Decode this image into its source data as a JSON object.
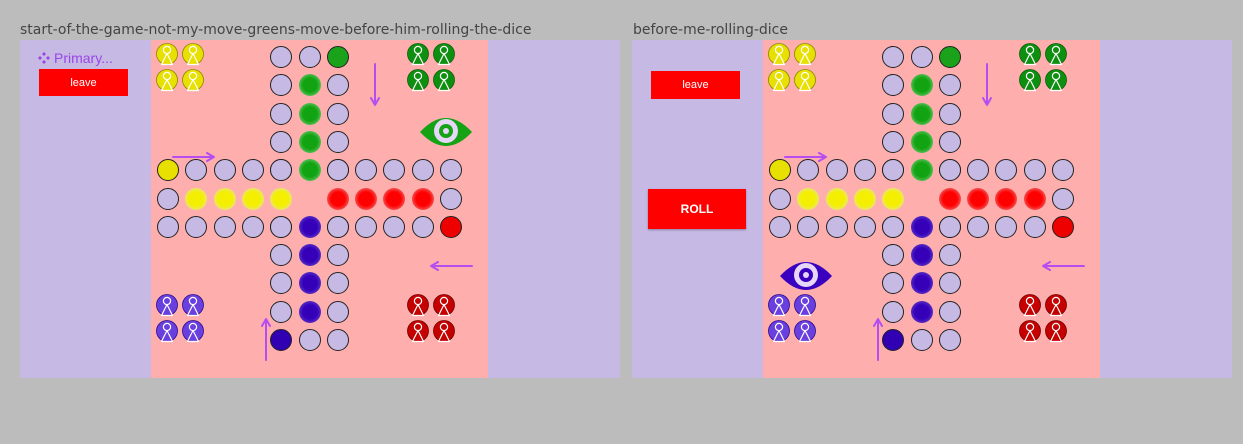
{
  "frames": [
    {
      "title": "start-of-the-game-not-my-move-greens-move-before-him-rolling-the-dice",
      "primary_label": "Primary...",
      "leave_label": "leave",
      "roll_label": "",
      "eye_player": "green"
    },
    {
      "title": "before-me-rolling-dice",
      "primary_label": "",
      "leave_label": "leave",
      "roll_label": "ROLL",
      "eye_player": "blue"
    }
  ],
  "colors": {
    "background": "#bcbcbc",
    "frame": "#c6b9e4",
    "board": "#ffaeae",
    "green": "#1aa31a",
    "yellow": "#e8e000",
    "red": "#ee0000",
    "blue": "#3200b3",
    "button": "#ff0000",
    "arrow": "#b44ef0"
  },
  "icons": [
    "pawn-icon",
    "eye-icon",
    "arrow-icon",
    "component-icon"
  ]
}
